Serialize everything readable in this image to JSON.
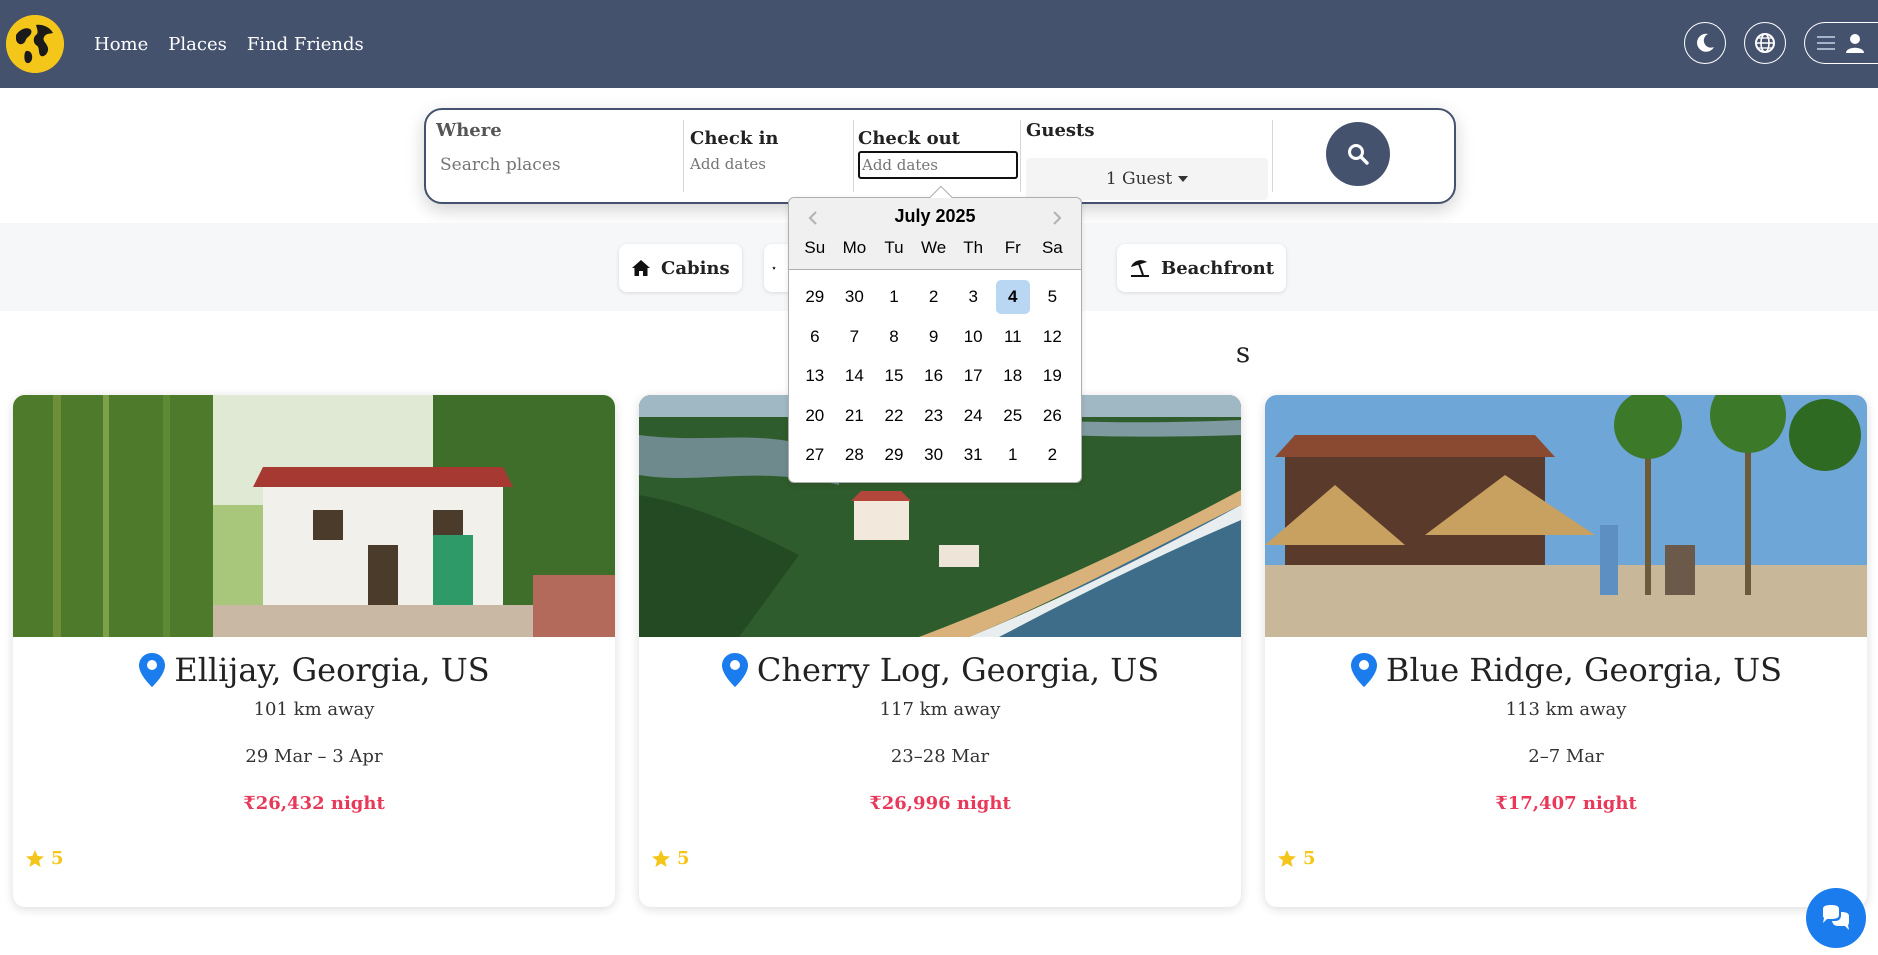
{
  "nav": {
    "logo": "globe-logo",
    "links": [
      {
        "label": "Home"
      },
      {
        "label": "Places"
      },
      {
        "label": "Find Friends"
      }
    ],
    "right_icons": [
      "moon-icon",
      "globe-icon",
      "hamburger-icon",
      "user-icon"
    ]
  },
  "search": {
    "where_label": "Where",
    "where_placeholder": "Search places",
    "checkin_label": "Check in",
    "checkin_placeholder": "Add dates",
    "checkout_label": "Check out",
    "checkout_placeholder": "Add dates",
    "guests_label": "Guests",
    "guests_value": "1 Guest"
  },
  "datepicker": {
    "month": "July 2025",
    "weekdays": [
      "Su",
      "Mo",
      "Tu",
      "We",
      "Th",
      "Fr",
      "Sa"
    ],
    "weeks": [
      [
        "29",
        "30",
        "1",
        "2",
        "3",
        "4",
        "5"
      ],
      [
        "6",
        "7",
        "8",
        "9",
        "10",
        "11",
        "12"
      ],
      [
        "13",
        "14",
        "15",
        "16",
        "17",
        "18",
        "19"
      ],
      [
        "20",
        "21",
        "22",
        "23",
        "24",
        "25",
        "26"
      ],
      [
        "27",
        "28",
        "29",
        "30",
        "31",
        "1",
        "2"
      ]
    ],
    "selected": "4"
  },
  "categories": [
    {
      "label": "Cabins",
      "icon": "home-icon"
    },
    {
      "label": "",
      "icon": "star-icon"
    },
    {
      "label": "Beachfront",
      "icon": "umbrella-beach-icon"
    }
  ],
  "section_heading": "s",
  "listings": [
    {
      "title": "Ellijay, Georgia, US",
      "distance": "101 km away",
      "dates": "29 Mar – 3 Apr",
      "price": "₹26,432 night",
      "rating": "5"
    },
    {
      "title": "Cherry Log, Georgia, US",
      "distance": "117 km away",
      "dates": "23–28 Mar",
      "price": "₹26,996 night",
      "rating": "5"
    },
    {
      "title": "Blue Ridge, Georgia, US",
      "distance": "113 km away",
      "dates": "2–7 Mar",
      "price": "₹17,407 night",
      "rating": "5"
    }
  ],
  "colors": {
    "navbar": "#45526e",
    "logo_yellow": "#f4c61a",
    "price_red": "#e8395a",
    "pin_blue": "#1b7ced",
    "selected_day": "#b9d7f3"
  }
}
